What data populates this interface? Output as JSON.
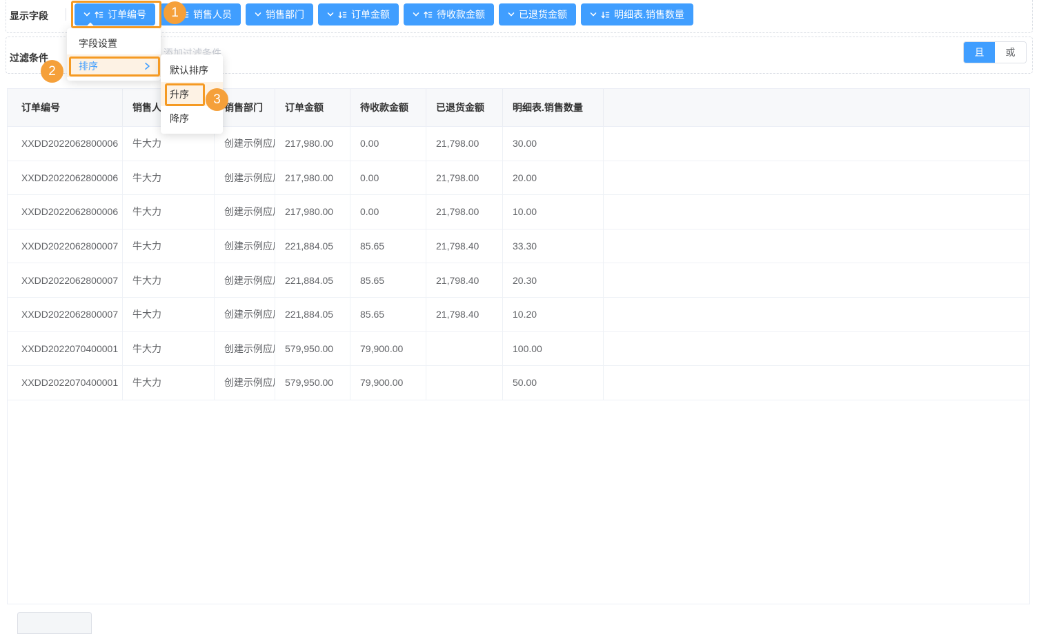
{
  "display_fields": {
    "label": "显示字段",
    "buttons": [
      {
        "label": "订单编号",
        "sort": "asc"
      },
      {
        "label": "销售人员",
        "sort": "asc"
      },
      {
        "label": "销售部门",
        "sort": "none"
      },
      {
        "label": "订单金额",
        "sort": "desc"
      },
      {
        "label": "待收款金额",
        "sort": "asc"
      },
      {
        "label": "已退货金额",
        "sort": "none"
      },
      {
        "label": "明细表.销售数量",
        "sort": "desc"
      }
    ]
  },
  "field_menu": {
    "items": [
      {
        "label": "字段设置",
        "highlighted": false,
        "has_submenu": false
      },
      {
        "label": "排序",
        "highlighted": true,
        "has_submenu": true
      }
    ]
  },
  "sort_submenu": {
    "items": [
      {
        "label": "默认排序",
        "highlighted": false
      },
      {
        "label": "升序",
        "highlighted": true
      },
      {
        "label": "降序",
        "highlighted": false
      }
    ]
  },
  "filter": {
    "label": "过滤条件",
    "add_placeholder": "添加过滤条件",
    "conjunction": {
      "and_label": "且",
      "or_label": "或",
      "active": "且"
    }
  },
  "annotations": {
    "step1": "1",
    "step2": "2",
    "step3": "3"
  },
  "table": {
    "headers": [
      "订单编号",
      "销售人员",
      "销售部门",
      "订单金额",
      "待收款金额",
      "已退货金额",
      "明细表.销售数量"
    ],
    "rows": [
      [
        "XXDD2022062800006",
        "牛大力",
        "创建示例应用",
        "217,980.00",
        "0.00",
        "21,798.00",
        "30.00"
      ],
      [
        "XXDD2022062800006",
        "牛大力",
        "创建示例应用",
        "217,980.00",
        "0.00",
        "21,798.00",
        "20.00"
      ],
      [
        "XXDD2022062800006",
        "牛大力",
        "创建示例应用",
        "217,980.00",
        "0.00",
        "21,798.00",
        "10.00"
      ],
      [
        "XXDD2022062800007",
        "牛大力",
        "创建示例应用",
        "221,884.05",
        "85.65",
        "21,798.40",
        "33.30"
      ],
      [
        "XXDD2022062800007",
        "牛大力",
        "创建示例应用",
        "221,884.05",
        "85.65",
        "21,798.40",
        "20.30"
      ],
      [
        "XXDD2022062800007",
        "牛大力",
        "创建示例应用",
        "221,884.05",
        "85.65",
        "21,798.40",
        "10.20"
      ],
      [
        "XXDD2022070400001",
        "牛大力",
        "创建示例应用",
        "579,950.00",
        "79,900.00",
        "",
        "100.00"
      ],
      [
        "XXDD2022070400001",
        "牛大力",
        "创建示例应用",
        "579,950.00",
        "79,900.00",
        "",
        "50.00"
      ]
    ]
  },
  "colors": {
    "primary_blue": "#409EFF",
    "annotation_orange": "#F59A23",
    "annotation_fill": "#FDF2E4",
    "header_bg": "#F7F8FA",
    "table_border": "#EBEEF5",
    "text_dark": "#333333",
    "text_body": "#606266",
    "text_muted": "#C8CCD4"
  }
}
